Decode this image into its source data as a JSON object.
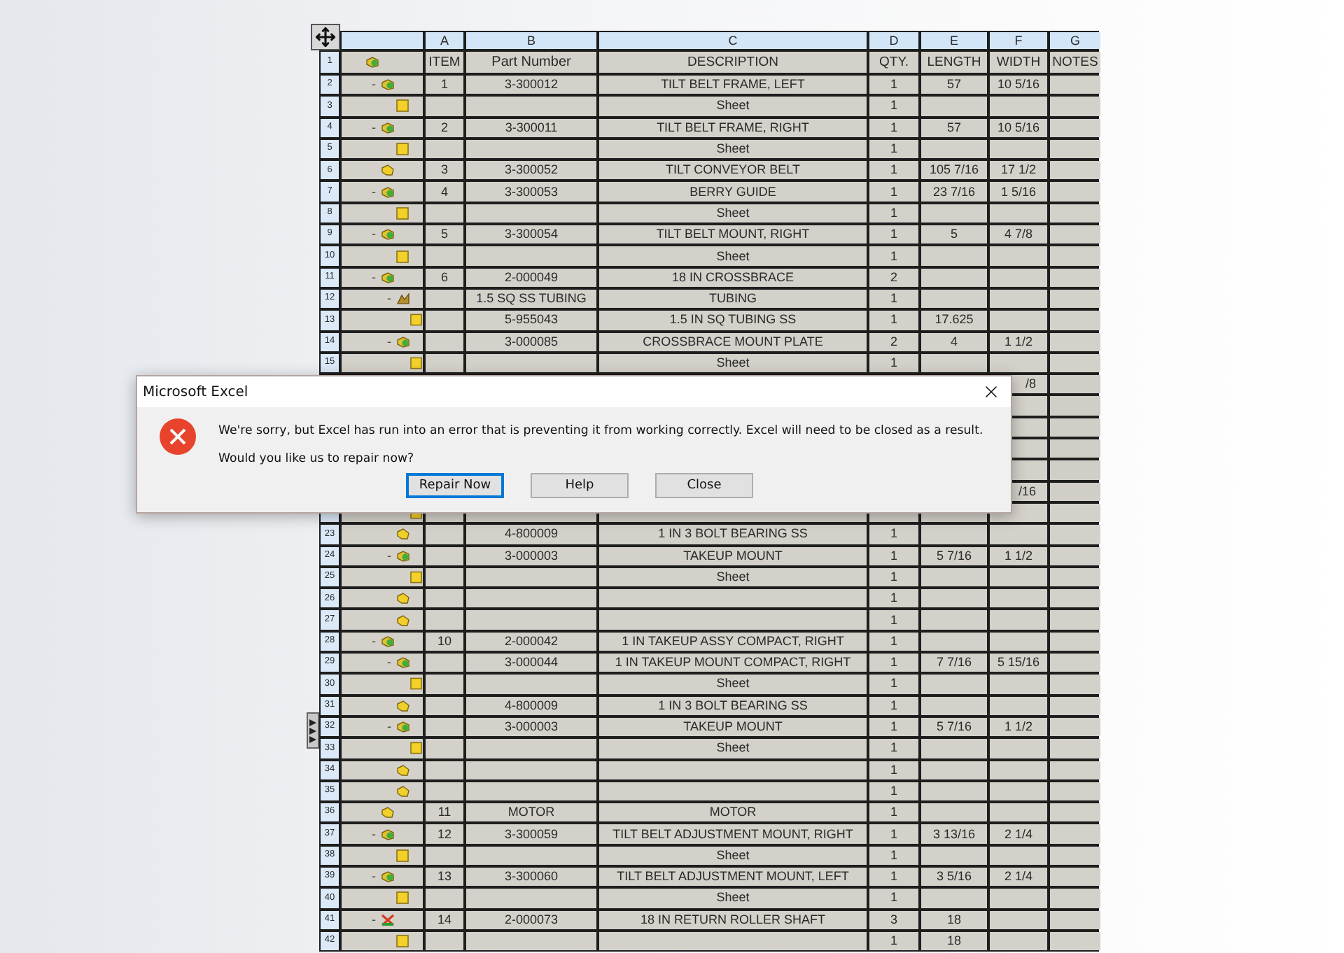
{
  "table": {
    "columns": [
      "A",
      "B",
      "C",
      "D",
      "E",
      "F",
      "G"
    ],
    "header": {
      "row": "1",
      "kind": "assembly",
      "item": "ITEM",
      "part_number": "Part Number",
      "description": "DESCRIPTION",
      "qty": "QTY.",
      "length": "LENGTH",
      "width": "WIDTH",
      "notes": "NOTES"
    },
    "rows": [
      {
        "row": "2",
        "toggle": "-",
        "kind": "assembly",
        "item": "1",
        "part_number": "3-300012",
        "description": "TILT BELT FRAME, LEFT",
        "qty": "1",
        "length": "57",
        "width": "10 5/16",
        "children": [
          {
            "row": "3",
            "kind": "sheet",
            "description": "Sheet",
            "qty": "1"
          }
        ]
      },
      {
        "row": "4",
        "toggle": "-",
        "kind": "assembly",
        "item": "2",
        "part_number": "3-300011",
        "description": "TILT BELT FRAME, RIGHT",
        "qty": "1",
        "length": "57",
        "width": "10 5/16",
        "children": [
          {
            "row": "5",
            "kind": "sheet",
            "description": "Sheet",
            "qty": "1"
          }
        ]
      },
      {
        "row": "6",
        "kind": "part",
        "item": "3",
        "part_number": "3-300052",
        "description": "TILT CONVEYOR BELT",
        "qty": "1",
        "length": "105 7/16",
        "width": "17 1/2"
      },
      {
        "row": "7",
        "toggle": "-",
        "kind": "assembly",
        "item": "4",
        "part_number": "3-300053",
        "description": "BERRY GUIDE",
        "qty": "1",
        "length": "23 7/16",
        "width": "1 5/16",
        "children": [
          {
            "row": "8",
            "kind": "sheet",
            "description": "Sheet",
            "qty": "1"
          }
        ]
      },
      {
        "row": "9",
        "toggle": "-",
        "kind": "assembly",
        "item": "5",
        "part_number": "3-300054",
        "description": "TILT BELT MOUNT, RIGHT",
        "qty": "1",
        "length": "5",
        "width": "4 7/8",
        "children": [
          {
            "row": "10",
            "kind": "sheet",
            "description": "Sheet",
            "qty": "1"
          }
        ]
      },
      {
        "row": "11",
        "toggle": "-",
        "kind": "assembly",
        "item": "6",
        "part_number": "2-000049",
        "description": "18 IN CROSSBRACE",
        "qty": "2",
        "children": [
          {
            "row": "12",
            "toggle": "-",
            "kind": "cutlist",
            "part_number": "1.5 SQ SS TUBING",
            "description": "TUBING",
            "qty": "1",
            "children": [
              {
                "row": "13",
                "kind": "sheet",
                "part_number": "5-955043",
                "description": "1.5 IN SQ TUBING SS",
                "qty": "1",
                "length": "17.625"
              }
            ]
          },
          {
            "row": "14",
            "toggle": "-",
            "kind": "assembly",
            "part_number": "3-000085",
            "description": "CROSSBRACE MOUNT PLATE",
            "qty": "2",
            "length": "4",
            "width": "1 1/2",
            "children": [
              {
                "row": "15",
                "kind": "sheet",
                "description": "Sheet",
                "qty": "1"
              }
            ]
          },
          {
            "covered": true,
            "width": "/8"
          },
          {
            "covered": true
          },
          {
            "covered": true
          },
          {
            "covered": true
          }
        ]
      },
      {
        "covered": true,
        "children": [
          {
            "covered": true,
            "width": "/16",
            "children": [
              {
                "kind": "sheet"
              }
            ]
          },
          {
            "row": "23",
            "kind": "part",
            "part_number": "4-800009",
            "description": "1 IN 3 BOLT BEARING SS",
            "qty": "1"
          },
          {
            "row": "24",
            "toggle": "-",
            "kind": "assembly",
            "part_number": "3-000003",
            "description": "TAKEUP MOUNT",
            "qty": "1",
            "length": "5 7/16",
            "width": "1 1/2",
            "children": [
              {
                "row": "25",
                "kind": "sheet",
                "description": "Sheet",
                "qty": "1"
              }
            ]
          },
          {
            "row": "26",
            "kind": "part",
            "qty": "1"
          },
          {
            "row": "27",
            "kind": "part",
            "qty": "1"
          }
        ]
      },
      {
        "row": "28",
        "toggle": "-",
        "kind": "assembly",
        "item": "10",
        "part_number": "2-000042",
        "description": "1 IN TAKEUP ASSY COMPACT, RIGHT",
        "qty": "1",
        "children": [
          {
            "row": "29",
            "toggle": "-",
            "kind": "assembly",
            "part_number": "3-000044",
            "description": "1 IN TAKEUP MOUNT COMPACT, RIGHT",
            "qty": "1",
            "length": "7 7/16",
            "width": "5 15/16",
            "children": [
              {
                "row": "30",
                "kind": "sheet",
                "description": "Sheet",
                "qty": "1"
              }
            ]
          },
          {
            "row": "31",
            "kind": "part",
            "part_number": "4-800009",
            "description": "1 IN 3 BOLT BEARING SS",
            "qty": "1"
          },
          {
            "row": "32",
            "toggle": "-",
            "kind": "assembly",
            "part_number": "3-000003",
            "description": "TAKEUP MOUNT",
            "qty": "1",
            "length": "5 7/16",
            "width": "1 1/2",
            "children": [
              {
                "row": "33",
                "kind": "sheet",
                "description": "Sheet",
                "qty": "1"
              }
            ]
          },
          {
            "row": "34",
            "kind": "part",
            "qty": "1"
          },
          {
            "row": "35",
            "kind": "part",
            "qty": "1"
          }
        ]
      },
      {
        "row": "36",
        "kind": "part",
        "item": "11",
        "part_number": "MOTOR",
        "description": "MOTOR",
        "qty": "1"
      },
      {
        "row": "37",
        "toggle": "-",
        "kind": "assembly",
        "item": "12",
        "part_number": "3-300059",
        "description": "TILT BELT ADJUSTMENT MOUNT, RIGHT",
        "qty": "1",
        "length": "3 13/16",
        "width": "2 1/4",
        "children": [
          {
            "row": "38",
            "kind": "sheet",
            "description": "Sheet",
            "qty": "1"
          }
        ]
      },
      {
        "row": "39",
        "toggle": "-",
        "kind": "assembly",
        "item": "13",
        "part_number": "3-300060",
        "description": "TILT BELT ADJUSTMENT MOUNT, LEFT",
        "qty": "1",
        "length": "3 5/16",
        "width": "2 1/4",
        "children": [
          {
            "row": "40",
            "kind": "sheet",
            "description": "Sheet",
            "qty": "1"
          }
        ]
      },
      {
        "row": "41",
        "toggle": "-",
        "kind": "weldment",
        "item": "14",
        "part_number": "2-000073",
        "description": "18 IN RETURN ROLLER SHAFT",
        "qty": "3",
        "length": "18",
        "children": [
          {
            "row": "42",
            "kind": "sheet",
            "qty": "1",
            "length": "18"
          }
        ]
      }
    ]
  },
  "dialog": {
    "title": "Microsoft Excel",
    "message": "We're sorry, but Excel has run into an error that is preventing it from working correctly. Excel will need to be closed as a result.",
    "question": "Would you like us to repair now?",
    "buttons": [
      {
        "label": "Repair Now",
        "focused": true
      },
      {
        "label": "Help",
        "focused": false
      },
      {
        "label": "Close",
        "focused": false
      }
    ]
  }
}
